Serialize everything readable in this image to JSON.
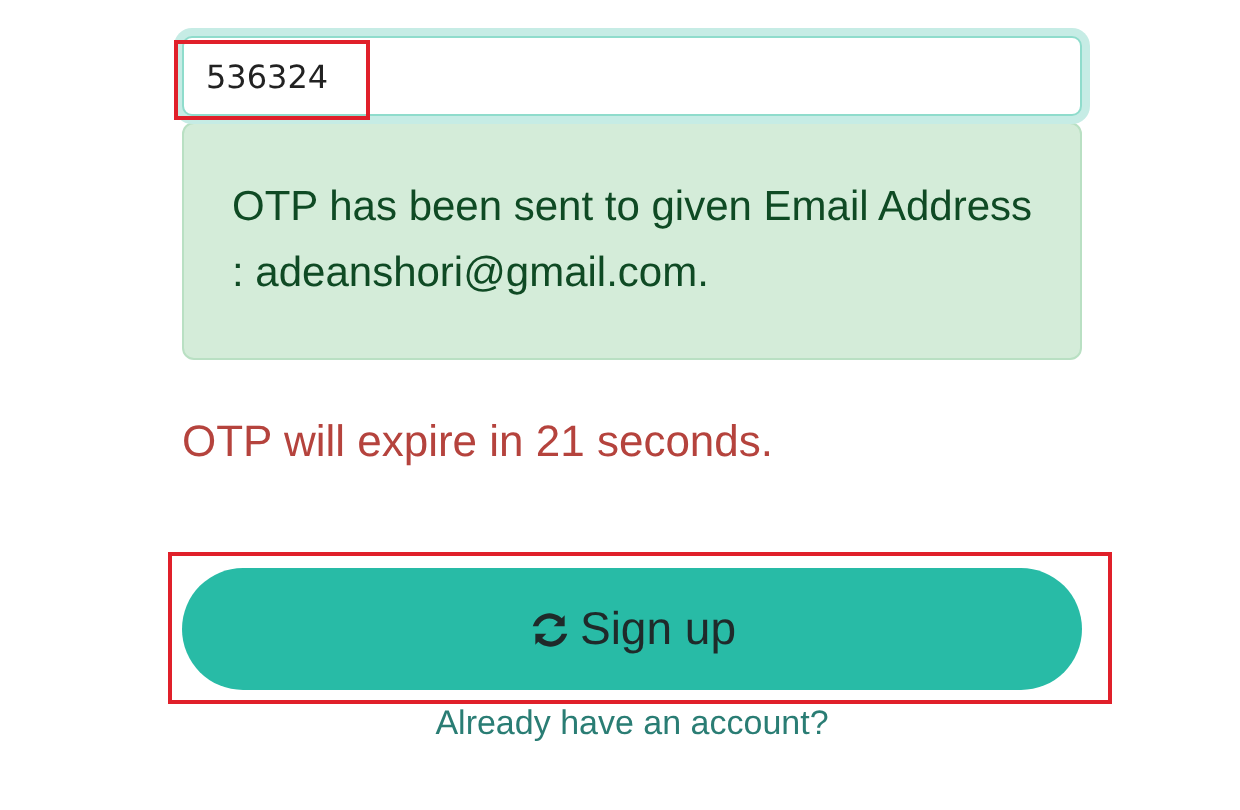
{
  "otp_field": {
    "value": "536324",
    "focused": true,
    "highlighted": true
  },
  "alert": {
    "text": "OTP has been sent to given Email Address : adeanshori@gmail.com."
  },
  "timer": {
    "text": "OTP will expire in 21 seconds."
  },
  "signup_button": {
    "label": "Sign up",
    "highlighted": true
  },
  "login_link": {
    "text": "Already have an account?"
  }
}
